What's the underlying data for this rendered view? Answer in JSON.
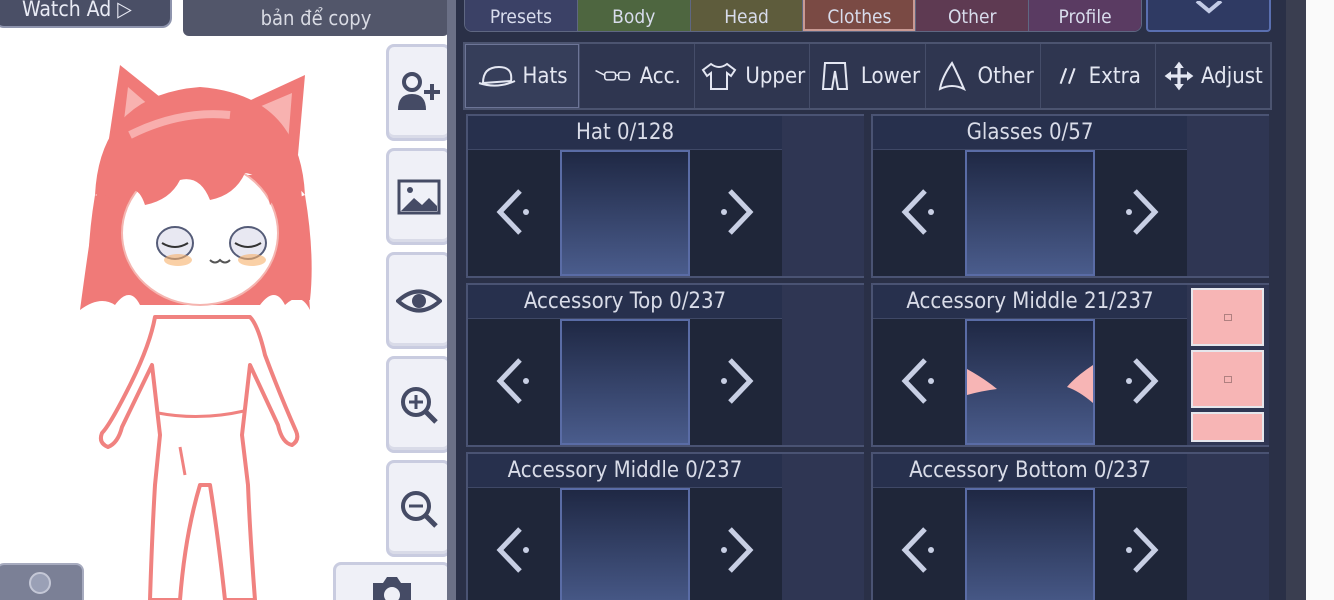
{
  "top_left": {
    "watch_ad": "Watch Ad ▷",
    "copy_label": "bản để copy"
  },
  "side_buttons": [
    {
      "icon": "add-person-icon"
    },
    {
      "icon": "image-icon"
    },
    {
      "icon": "eye-icon"
    },
    {
      "icon": "zoom-in-icon"
    },
    {
      "icon": "zoom-out-icon"
    }
  ],
  "top_tabs": [
    {
      "label": "Presets",
      "color": "#3b4166"
    },
    {
      "label": "Body",
      "color": "#4e6640"
    },
    {
      "label": "Head",
      "color": "#5e5c3c"
    },
    {
      "label": "Clothes",
      "color": "#7a4a44"
    },
    {
      "label": "Other",
      "color": "#5e3a52"
    },
    {
      "label": "Profile",
      "color": "#5a3b62"
    }
  ],
  "sub_tabs": [
    {
      "label": "Hats",
      "icon": "hat-icon"
    },
    {
      "label": "Acc.",
      "icon": "glasses-icon"
    },
    {
      "label": "Upper",
      "icon": "shirt-icon"
    },
    {
      "label": "Lower",
      "icon": "pants-icon"
    },
    {
      "label": "Other",
      "icon": "cone-icon"
    },
    {
      "label": "Extra",
      "icon": "slashes-icon"
    },
    {
      "label": "Adjust",
      "icon": "move-icon"
    }
  ],
  "slots": [
    {
      "title": "Hat 0/128"
    },
    {
      "title": "Glasses 0/57"
    },
    {
      "title": "Accessory Top 0/237"
    },
    {
      "title": "Accessory Middle 21/237"
    },
    {
      "title": "Accessory Middle 0/237"
    },
    {
      "title": "Accessory Bottom 0/237"
    }
  ],
  "colors": {
    "panel": "#2a3047",
    "swatch": "#f7b5b5",
    "hair": "#f07a78"
  }
}
